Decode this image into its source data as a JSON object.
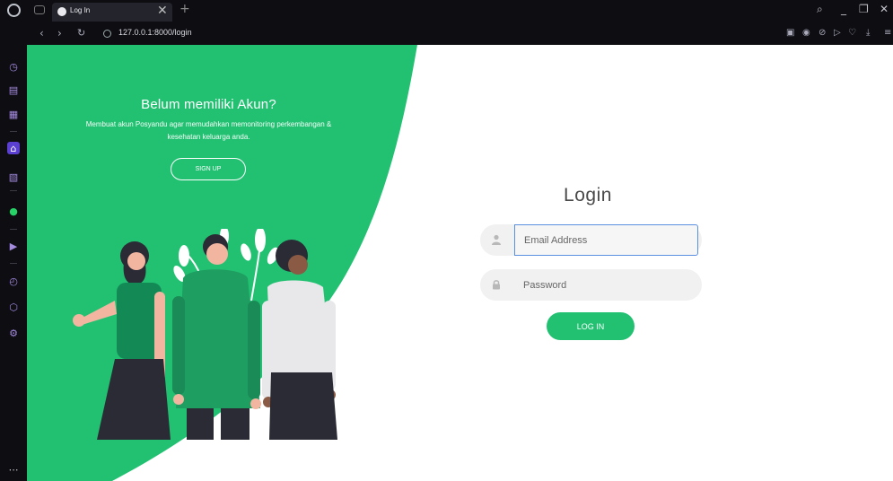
{
  "browser": {
    "tab_title": "Log In",
    "new_tab": "+",
    "close_tab": "✕",
    "url": "127.0.0.1:8000/login",
    "window_controls": {
      "search": "⌕",
      "minimize": "_",
      "restore": "❐",
      "close": "✕"
    }
  },
  "page": {
    "cta_title": "Belum memiliki Akun?",
    "cta_text": "Membuat akun Posyandu agar memudahkan memonitoring perkembangan & kesehatan keluarga anda.",
    "signup_label": "SIGN UP",
    "login_title": "Login",
    "email_placeholder": "Email Address",
    "password_placeholder": "Password",
    "login_label": "LOG IN"
  },
  "colors": {
    "brand_green": "#22c172",
    "chrome_bg": "#0d0d12",
    "sidebar_accent": "#a58be0"
  }
}
